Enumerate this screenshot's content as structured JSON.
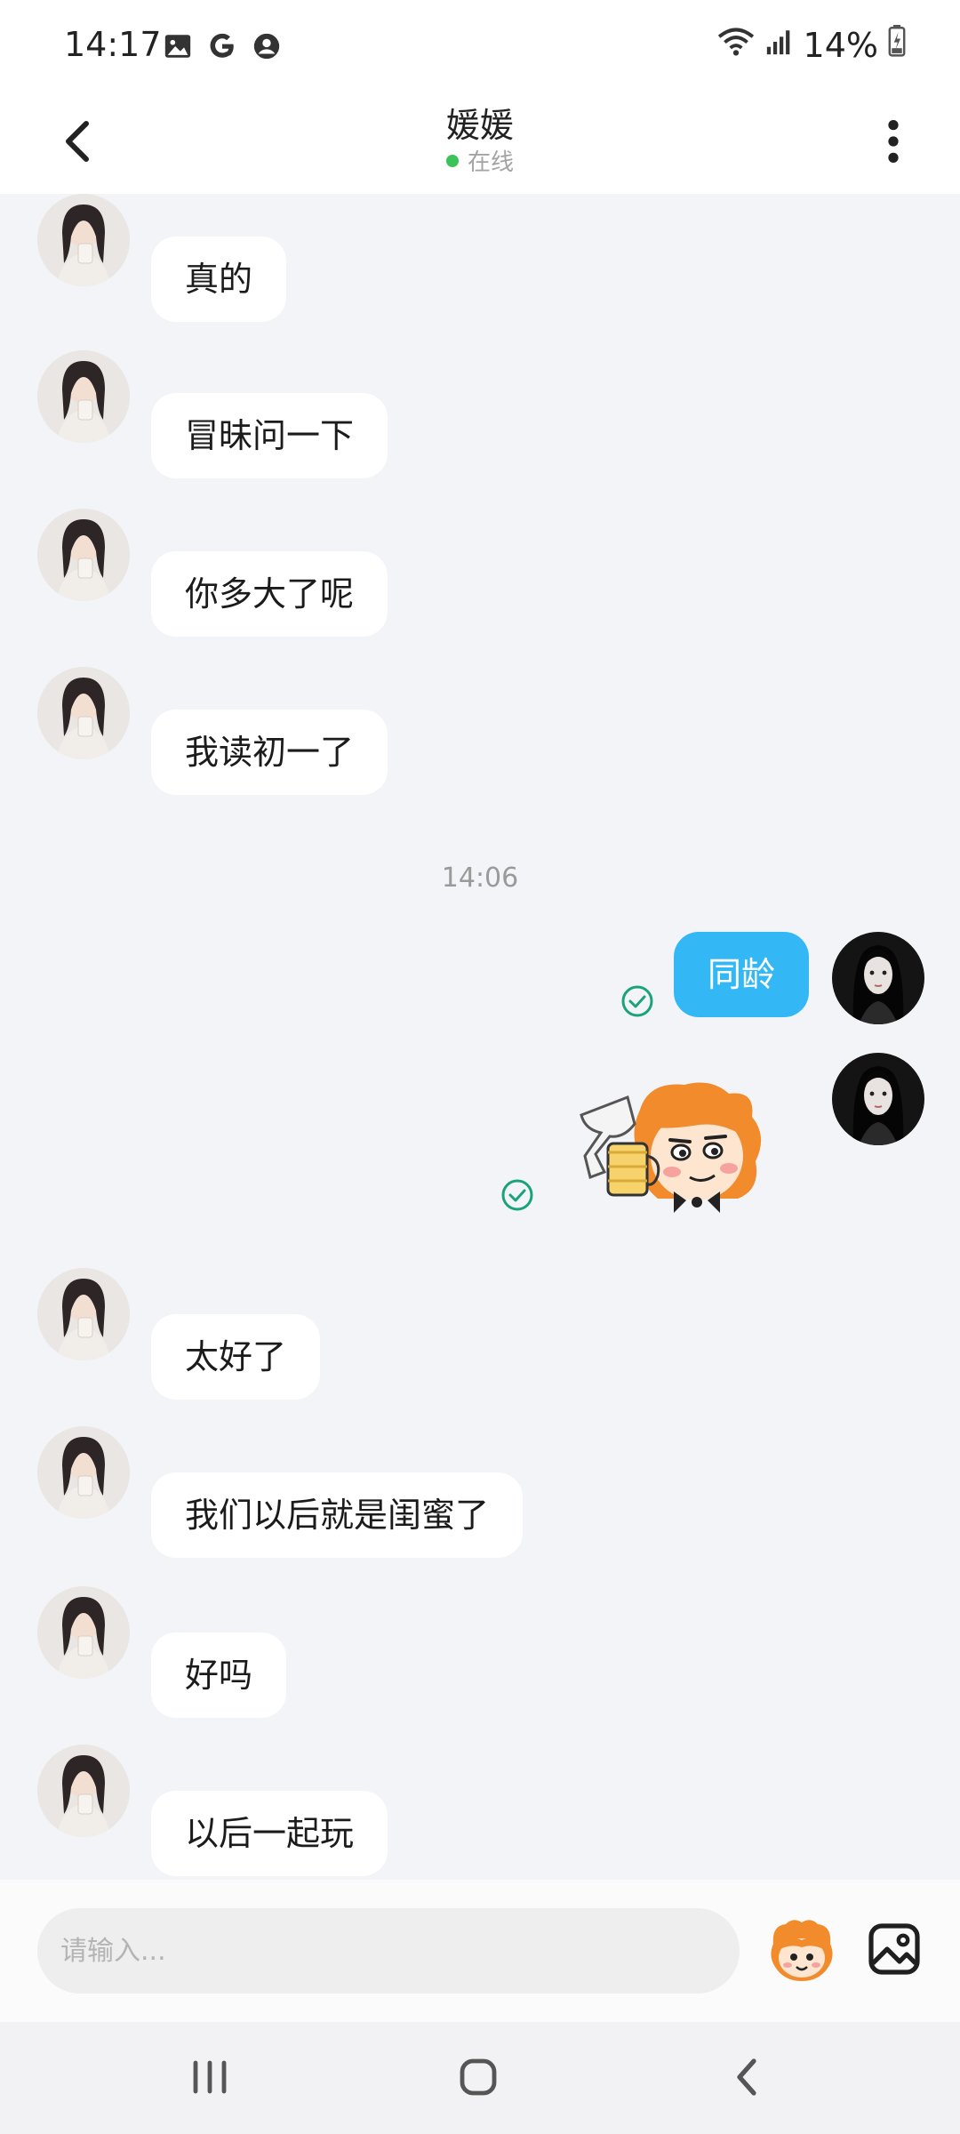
{
  "status_bar": {
    "time": "14:17",
    "left_icons": [
      "image-icon",
      "google-icon",
      "account-icon"
    ],
    "right_icons": [
      "wifi-icon",
      "signal-icon",
      "battery-charging-icon"
    ],
    "battery": "14%"
  },
  "header": {
    "title": "媛媛",
    "status": "在线",
    "status_color": "#3bc35a"
  },
  "messages": [
    {
      "side": "in",
      "text": "真的"
    },
    {
      "side": "in",
      "text": "冒昧问一下"
    },
    {
      "side": "in",
      "text": "你多大了呢"
    },
    {
      "side": "in",
      "text": "我读初一了"
    },
    {
      "type": "timestamp",
      "text": "14:06"
    },
    {
      "side": "out",
      "text": "同龄",
      "read": true
    },
    {
      "side": "out",
      "type": "sticker",
      "sticker": "cartoon-toast-sticker",
      "read": true
    },
    {
      "side": "in",
      "text": "太好了"
    },
    {
      "side": "in",
      "text": "我们以后就是闺蜜了"
    },
    {
      "side": "in",
      "text": "好吗"
    },
    {
      "side": "in",
      "text": "以后一起玩"
    }
  ],
  "input": {
    "placeholder": "请输入..."
  },
  "colors": {
    "outgoing_bubble": "#33b8f5",
    "incoming_bubble": "#ffffff",
    "chat_background": "#f3f4f7",
    "read_check": "#1aa37a"
  }
}
